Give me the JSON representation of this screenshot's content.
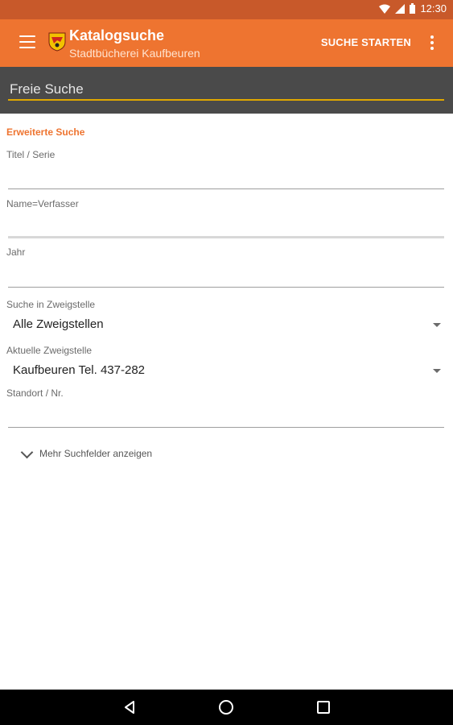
{
  "status_bar": {
    "time": "12:30",
    "icons": [
      "wifi-icon",
      "signal-icon",
      "battery-icon"
    ]
  },
  "app_bar": {
    "title": "Katalogsuche",
    "subtitle": "Stadtbücherei Kaufbeuren",
    "action_label": "SUCHE STARTEN",
    "icons": [
      "menu-icon",
      "library-crest-logo",
      "more-vert-icon"
    ]
  },
  "search": {
    "placeholder": "Freie Suche",
    "value": ""
  },
  "advanced": {
    "section_title": "Erweiterte Suche",
    "fields": [
      {
        "label": "Titel / Serie",
        "value": ""
      },
      {
        "label": "Name=Verfasser",
        "value": ""
      },
      {
        "label": "Jahr",
        "value": ""
      }
    ],
    "branch_label": "Suche in Zweigstelle",
    "branch_value": "Alle Zweigstellen",
    "current_branch_label": "Aktuelle Zweigstelle",
    "current_branch_value": "Kaufbeuren Tel. 437-282",
    "location_label": "Standort / Nr.",
    "location_value": "",
    "more_fields_label": "Mehr Suchfelder anzeigen"
  },
  "colors": {
    "accent": "#ee7430",
    "status_bar": "#c8592a",
    "search_bar": "#4a4a4a",
    "search_underline": "#e0a800"
  },
  "nav_bar": {
    "icons": [
      "back-icon",
      "home-icon",
      "recents-icon"
    ]
  }
}
